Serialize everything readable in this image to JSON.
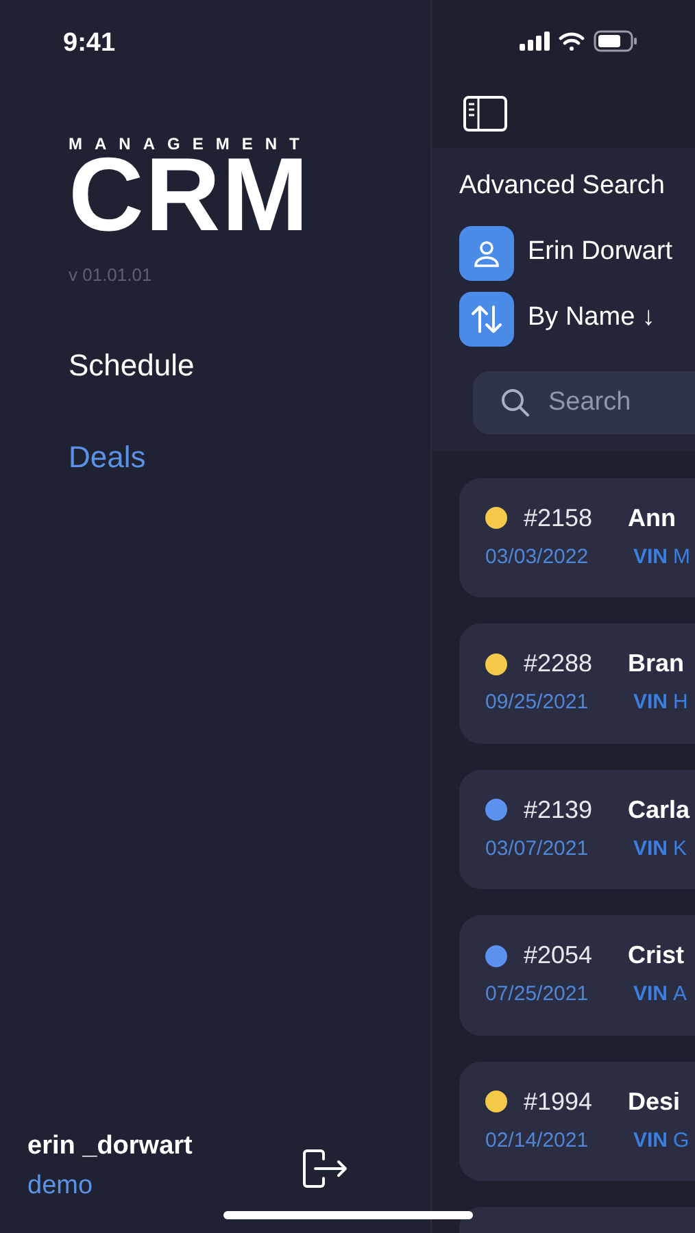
{
  "status_bar": {
    "time": "9:41"
  },
  "sidebar": {
    "logo": {
      "top": "MANAGEMENT",
      "main": "CRM"
    },
    "version": "v 01.01.01",
    "items": [
      {
        "label": "Schedule",
        "selected": false
      },
      {
        "label": "Deals",
        "selected": true
      }
    ],
    "user": {
      "name": "erin _dorwart",
      "role": "demo"
    }
  },
  "main": {
    "advanced_search": "Advanced Search",
    "assignee": "Erin Dorwart",
    "sort": "By Name ↓",
    "search": {
      "placeholder": "Search"
    },
    "deals": [
      {
        "number": "#2158",
        "name": "Ann",
        "date": "03/03/2022",
        "vin_label": "VIN",
        "vin": "M",
        "color": "#f5c94a"
      },
      {
        "number": "#2288",
        "name": "Bran",
        "date": "09/25/2021",
        "vin_label": "VIN",
        "vin": "H",
        "color": "#f5c94a"
      },
      {
        "number": "#2139",
        "name": "Carla",
        "date": "03/07/2021",
        "vin_label": "VIN",
        "vin": "K",
        "color": "#5b92f0"
      },
      {
        "number": "#2054",
        "name": "Crist",
        "date": "07/25/2021",
        "vin_label": "VIN",
        "vin": "A",
        "color": "#5b92f0"
      },
      {
        "number": "#1994",
        "name": "Desi",
        "date": "02/14/2021",
        "vin_label": "VIN",
        "vin": "G",
        "color": "#f5c94a"
      }
    ]
  }
}
